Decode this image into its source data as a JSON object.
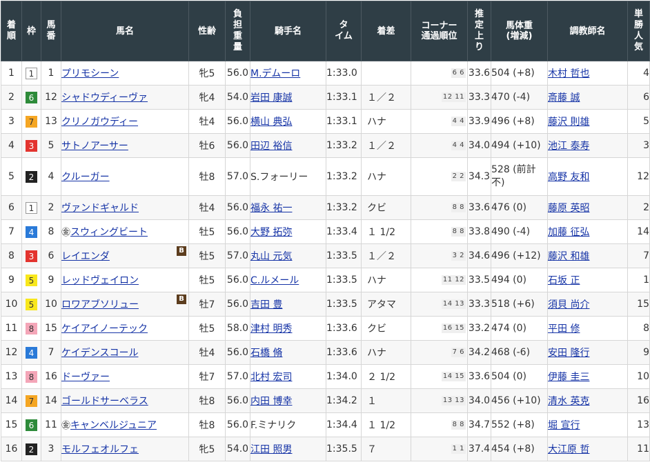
{
  "headers": {
    "finish": "着順",
    "frame": "枠",
    "number": "馬番",
    "horse": "馬名",
    "sex_age": "性齢",
    "weight": "負担重量",
    "jockey": "騎手名",
    "time": "タイム",
    "margin": "着差",
    "corner_l1": "コーナー",
    "corner_l2": "通過順位",
    "last3f_l1": "推定",
    "last3f_l2": "上り",
    "bodyweight_l1": "馬体重",
    "bodyweight_l2": "(増減)",
    "trainer": "調教師名",
    "popularity": "単勝人気"
  },
  "frame_colors": {
    "1": {
      "bg": "#ffffff",
      "fg": "#333333",
      "border": "#999999"
    },
    "2": {
      "bg": "#222222",
      "fg": "#ffffff",
      "border": "#222222"
    },
    "3": {
      "bg": "#e3342f",
      "fg": "#ffffff",
      "border": "#e3342f"
    },
    "4": {
      "bg": "#2a7ad8",
      "fg": "#ffffff",
      "border": "#2a7ad8"
    },
    "5": {
      "bg": "#f8e71c",
      "fg": "#333333",
      "border": "#f8e71c"
    },
    "6": {
      "bg": "#2e8b3a",
      "fg": "#ffffff",
      "border": "#2e8b3a"
    },
    "7": {
      "bg": "#f5a623",
      "fg": "#333333",
      "border": "#f5a623"
    },
    "8": {
      "bg": "#f4a6b8",
      "fg": "#333333",
      "border": "#f4a6b8"
    }
  },
  "rows": [
    {
      "finish": "1",
      "frame": "1",
      "number": "1",
      "foreign": "",
      "horse": "プリモシーン",
      "blinker": "",
      "sex_age": "牝5",
      "weight": "56.0",
      "jockey": "M.デムーロ",
      "jockey_link": true,
      "time": "1:33.0",
      "margin": "",
      "corner": [
        "6",
        "6"
      ],
      "last3f": "33.6",
      "bodyweight": "504 (+8)",
      "trainer": "木村 哲也",
      "popularity": "4"
    },
    {
      "finish": "2",
      "frame": "6",
      "number": "12",
      "foreign": "",
      "horse": "シャドウディーヴァ",
      "blinker": "",
      "sex_age": "牝4",
      "weight": "54.0",
      "jockey": "岩田 康誠",
      "jockey_link": true,
      "time": "1:33.1",
      "margin": "１／２",
      "corner": [
        "12",
        "11"
      ],
      "last3f": "33.3",
      "bodyweight": "470 (-4)",
      "trainer": "斎藤 誠",
      "popularity": "6"
    },
    {
      "finish": "3",
      "frame": "7",
      "number": "13",
      "foreign": "",
      "horse": "クリノガウディー",
      "blinker": "",
      "sex_age": "牡4",
      "weight": "56.0",
      "jockey": "横山 典弘",
      "jockey_link": true,
      "time": "1:33.1",
      "margin": "ハナ",
      "corner": [
        "4",
        "4"
      ],
      "last3f": "33.9",
      "bodyweight": "496 (+8)",
      "trainer": "藤沢 則雄",
      "popularity": "5"
    },
    {
      "finish": "4",
      "frame": "3",
      "number": "5",
      "foreign": "",
      "horse": "サトノアーサー",
      "blinker": "",
      "sex_age": "牡6",
      "weight": "56.0",
      "jockey": "田辺 裕信",
      "jockey_link": true,
      "time": "1:33.2",
      "margin": "１／２",
      "corner": [
        "4",
        "4"
      ],
      "last3f": "34.0",
      "bodyweight": "494 (+10)",
      "trainer": "池江 泰寿",
      "popularity": "3"
    },
    {
      "finish": "5",
      "frame": "2",
      "number": "4",
      "foreign": "",
      "horse": "クルーガー",
      "blinker": "",
      "sex_age": "牡8",
      "weight": "57.0",
      "jockey": "S.フォーリー",
      "jockey_link": false,
      "time": "1:33.2",
      "margin": "ハナ",
      "corner": [
        "2",
        "2"
      ],
      "last3f": "34.3",
      "bodyweight": "528 (前計不)",
      "trainer": "高野 友和",
      "popularity": "12",
      "tall": true
    },
    {
      "finish": "6",
      "frame": "1",
      "number": "2",
      "foreign": "",
      "horse": "ヴァンドギャルド",
      "blinker": "",
      "sex_age": "牡4",
      "weight": "56.0",
      "jockey": "福永 祐一",
      "jockey_link": true,
      "time": "1:33.2",
      "margin": "クビ",
      "corner": [
        "8",
        "8"
      ],
      "last3f": "33.6",
      "bodyweight": "476 (0)",
      "trainer": "藤原 英昭",
      "popularity": "2"
    },
    {
      "finish": "7",
      "frame": "4",
      "number": "8",
      "foreign": "㊎",
      "horse": "スウィングビート",
      "blinker": "",
      "sex_age": "牡5",
      "weight": "56.0",
      "jockey": "大野 拓弥",
      "jockey_link": true,
      "time": "1:33.4",
      "margin": "１ 1/2",
      "corner": [
        "8",
        "8"
      ],
      "last3f": "33.8",
      "bodyweight": "490 (-4)",
      "trainer": "加藤 征弘",
      "popularity": "14"
    },
    {
      "finish": "8",
      "frame": "3",
      "number": "6",
      "foreign": "",
      "horse": "レイエンダ",
      "blinker": "B",
      "sex_age": "牡5",
      "weight": "57.0",
      "jockey": "丸山 元気",
      "jockey_link": true,
      "time": "1:33.5",
      "margin": "１／２",
      "corner": [
        "3",
        "2"
      ],
      "last3f": "34.6",
      "bodyweight": "496 (+12)",
      "trainer": "藤沢 和雄",
      "popularity": "7"
    },
    {
      "finish": "9",
      "frame": "5",
      "number": "9",
      "foreign": "",
      "horse": "レッドヴェイロン",
      "blinker": "",
      "sex_age": "牡5",
      "weight": "56.0",
      "jockey": "C.ルメール",
      "jockey_link": true,
      "time": "1:33.5",
      "margin": "ハナ",
      "corner": [
        "11",
        "12"
      ],
      "last3f": "33.5",
      "bodyweight": "494 (0)",
      "trainer": "石坂 正",
      "popularity": "1"
    },
    {
      "finish": "10",
      "frame": "5",
      "number": "10",
      "foreign": "",
      "horse": "ロワアブソリュー",
      "blinker": "B",
      "sex_age": "牡7",
      "weight": "56.0",
      "jockey": "吉田 豊",
      "jockey_link": true,
      "time": "1:33.5",
      "margin": "アタマ",
      "corner": [
        "14",
        "13"
      ],
      "last3f": "33.3",
      "bodyweight": "518 (+6)",
      "trainer": "須貝 尚介",
      "popularity": "15"
    },
    {
      "finish": "11",
      "frame": "8",
      "number": "15",
      "foreign": "",
      "horse": "ケイアイノーテック",
      "blinker": "",
      "sex_age": "牡5",
      "weight": "58.0",
      "jockey": "津村 明秀",
      "jockey_link": true,
      "time": "1:33.6",
      "margin": "クビ",
      "corner": [
        "16",
        "15"
      ],
      "last3f": "33.2",
      "bodyweight": "474 (0)",
      "trainer": "平田 修",
      "popularity": "8"
    },
    {
      "finish": "12",
      "frame": "4",
      "number": "7",
      "foreign": "",
      "horse": "ケイデンスコール",
      "blinker": "",
      "sex_age": "牡4",
      "weight": "56.0",
      "jockey": "石橋 脩",
      "jockey_link": true,
      "time": "1:33.6",
      "margin": "ハナ",
      "corner": [
        "7",
        "6"
      ],
      "last3f": "34.2",
      "bodyweight": "468 (-6)",
      "trainer": "安田 隆行",
      "popularity": "9"
    },
    {
      "finish": "13",
      "frame": "8",
      "number": "16",
      "foreign": "",
      "horse": "ドーヴァー",
      "blinker": "",
      "sex_age": "牡7",
      "weight": "57.0",
      "jockey": "北村 宏司",
      "jockey_link": true,
      "time": "1:34.0",
      "margin": "２ 1/2",
      "corner": [
        "14",
        "15"
      ],
      "last3f": "33.6",
      "bodyweight": "504 (0)",
      "trainer": "伊藤 圭三",
      "popularity": "10"
    },
    {
      "finish": "14",
      "frame": "7",
      "number": "14",
      "foreign": "",
      "horse": "ゴールドサーベラス",
      "blinker": "",
      "sex_age": "牡8",
      "weight": "56.0",
      "jockey": "内田 博幸",
      "jockey_link": true,
      "time": "1:34.2",
      "margin": "１",
      "corner": [
        "13",
        "13"
      ],
      "last3f": "34.0",
      "bodyweight": "456 (+10)",
      "trainer": "清水 英克",
      "popularity": "16"
    },
    {
      "finish": "15",
      "frame": "6",
      "number": "11",
      "foreign": "㊎",
      "horse": "キャンベルジュニア",
      "blinker": "",
      "sex_age": "牡8",
      "weight": "56.0",
      "jockey": "F.ミナリク",
      "jockey_link": false,
      "time": "1:34.4",
      "margin": "１ 1/2",
      "corner": [
        "8",
        "8"
      ],
      "last3f": "34.7",
      "bodyweight": "552 (+8)",
      "trainer": "堀 宣行",
      "popularity": "13"
    },
    {
      "finish": "16",
      "frame": "2",
      "number": "3",
      "foreign": "",
      "horse": "モルフェオルフェ",
      "blinker": "",
      "sex_age": "牝5",
      "weight": "54.0",
      "jockey": "江田 照男",
      "jockey_link": true,
      "time": "1:35.5",
      "margin": "７",
      "corner": [
        "1",
        "1"
      ],
      "last3f": "37.4",
      "bodyweight": "454 (+8)",
      "trainer": "大江原 哲",
      "popularity": "11"
    }
  ]
}
